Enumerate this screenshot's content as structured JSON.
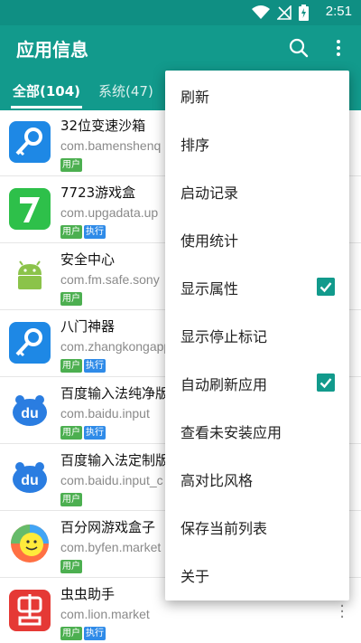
{
  "status": {
    "time": "2:51"
  },
  "appbar": {
    "title": "应用信息"
  },
  "tabs": [
    {
      "label": "全部(104)"
    },
    {
      "label": "系统(47)"
    }
  ],
  "apps": [
    {
      "name": "32位变速沙箱",
      "package": "com.bamenshenq",
      "badges": [
        "用户"
      ],
      "icon": "sandbox-key-icon"
    },
    {
      "name": "7723游戏盒",
      "package": "com.upgadata.up",
      "badges": [
        "用户",
        "执行"
      ],
      "icon": "game-box-7-icon"
    },
    {
      "name": "安全中心",
      "package": "com.fm.safe.sony",
      "badges": [
        "用户"
      ],
      "icon": "android-icon"
    },
    {
      "name": "八门神器",
      "package": "com.zhangkongapp",
      "badges": [
        "用户",
        "执行"
      ],
      "icon": "tool-key-icon"
    },
    {
      "name": "百度输入法纯净版",
      "package": "com.baidu.input",
      "badges": [
        "用户",
        "执行"
      ],
      "icon": "baidu-du-icon"
    },
    {
      "name": "百度输入法定制版",
      "package": "com.baidu.input_c",
      "badges": [
        "用户"
      ],
      "icon": "baidu-du-icon"
    },
    {
      "name": "百分网游戏盒子",
      "package": "com.byfen.market",
      "badges": [
        "用户"
      ],
      "icon": "smiley-ball-icon"
    },
    {
      "name": "虫虫助手",
      "package": "com.lion.market",
      "badges": [
        "用户",
        "执行"
      ],
      "icon": "chongchong-icon"
    }
  ],
  "menu": [
    {
      "label": "刷新",
      "checked": null
    },
    {
      "label": "排序",
      "checked": null
    },
    {
      "label": "启动记录",
      "checked": null
    },
    {
      "label": "使用统计",
      "checked": null
    },
    {
      "label": "显示属性",
      "checked": true
    },
    {
      "label": "显示停止标记",
      "checked": null
    },
    {
      "label": "自动刷新应用",
      "checked": true
    },
    {
      "label": "查看未安装应用",
      "checked": null
    },
    {
      "label": "高对比风格",
      "checked": null
    },
    {
      "label": "保存当前列表",
      "checked": null
    },
    {
      "label": "关于",
      "checked": null
    }
  ],
  "colors": {
    "primary": "#129a8c",
    "status_bar": "#0f8f83",
    "badge_user": "#4caf50",
    "badge_exec": "#2f8be8"
  }
}
